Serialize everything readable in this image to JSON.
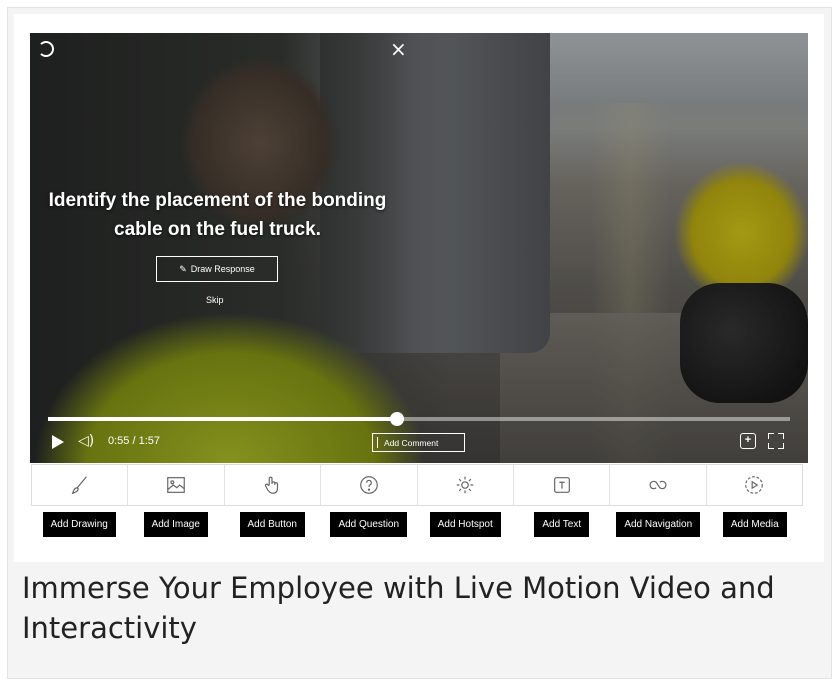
{
  "video": {
    "question": "Identify the placement of the bonding cable on the fuel truck.",
    "draw_response_label": "Draw Response",
    "skip_label": "Skip",
    "current_time": "0:55",
    "duration": "1:57",
    "time_display": "0:55 / 1:57",
    "progress_fraction": 0.47,
    "add_comment_label": "Add Comment"
  },
  "toolbar": {
    "tools": [
      {
        "label": "Add Drawing",
        "icon": "brush-icon"
      },
      {
        "label": "Add Image",
        "icon": "image-icon"
      },
      {
        "label": "Add Button",
        "icon": "pointer-hand-icon"
      },
      {
        "label": "Add Question",
        "icon": "question-icon"
      },
      {
        "label": "Add Hotspot",
        "icon": "hotspot-icon"
      },
      {
        "label": "Add Text",
        "icon": "text-icon"
      },
      {
        "label": "Add Navigation",
        "icon": "navigation-icon"
      },
      {
        "label": "Add Media",
        "icon": "media-icon"
      }
    ]
  },
  "headline": "Immerse Your Employee with Live Motion Video and Interactivity",
  "colors": {
    "card_background": "#f4f4f4",
    "label_chip": "#000000",
    "headline_text": "#222222"
  }
}
